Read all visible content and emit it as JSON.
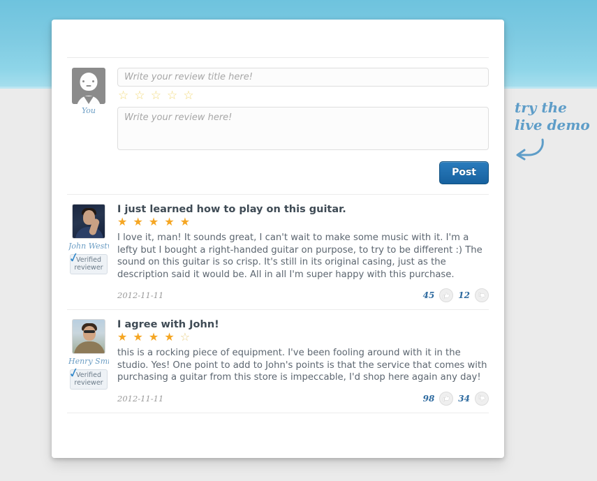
{
  "annotation": {
    "line1": "try the",
    "line2": "live demo",
    "arrow_icon": "curved-arrow-left-icon"
  },
  "write_form": {
    "avatar_label": "You",
    "avatar_icon": "user-placeholder-avatar",
    "title_placeholder": "Write your review title here!",
    "title_value": "",
    "body_placeholder": "Write your review here!",
    "body_value": "",
    "rating": 0,
    "max_rating": 5,
    "post_label": "Post"
  },
  "reviews": [
    {
      "author": "John Westwood",
      "avatar_icon": "user-photo-avatar",
      "verified_line1": "Verified",
      "verified_line2": "reviewer",
      "verified_icon": "check-ribbon-icon",
      "title": "I just learned how to play on this guitar.",
      "rating": 5,
      "max_rating": 5,
      "body": "I love it, man! It sounds great, I can't wait to make some music with it. I'm a lefty but I bought a right-handed guitar on purpose, to try to be different :) The sound on this guitar is so crisp. It's still in its original casing, just as the description said it would be. All in all I'm super happy with this purchase.",
      "date": "2012-11-11",
      "upvotes": "45",
      "downvotes": "12",
      "upvote_icon": "thumbs-up-icon",
      "downvote_icon": "thumbs-down-icon"
    },
    {
      "author": "Henry Smith",
      "avatar_icon": "user-photo-avatar",
      "verified_line1": "Verified",
      "verified_line2": "reviewer",
      "verified_icon": "check-ribbon-icon",
      "title": "I agree with John!",
      "rating": 4,
      "max_rating": 5,
      "body": "this is a rocking piece of equipment. I've been fooling around with it in the studio. Yes! One point to add to John's points is that the service that comes with purchasing a guitar from this store is impeccable, I'd shop here again any day!",
      "date": "2012-11-11",
      "upvotes": "98",
      "downvotes": "34",
      "upvote_icon": "thumbs-up-icon",
      "downvote_icon": "thumbs-down-icon"
    }
  ],
  "colors": {
    "accent_blue": "#2a7cbd",
    "star_gold": "#f5a623",
    "sky_top": "#6ec3de",
    "page_bg": "#ebebeb"
  }
}
